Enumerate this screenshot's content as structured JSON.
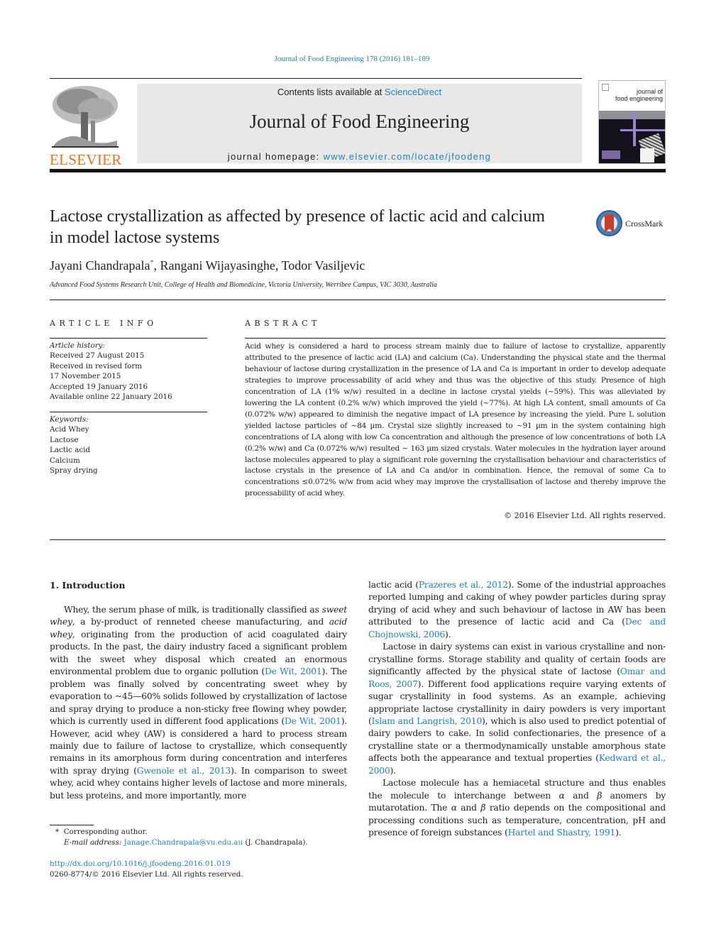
{
  "header": {
    "citation": "Journal of Food Engineering 178 (2016) 181–189",
    "publisher_logo_text": "ELSEVIER",
    "contents_prefix": "Contents lists available at ",
    "contents_link": "ScienceDirect",
    "journal_name": "Journal of Food Engineering",
    "homepage_prefix": "journal homepage: ",
    "homepage_link": "www.elsevier.com/locate/jfoodeng",
    "cover_title_line1": "journal of",
    "cover_title_line2": "food engineering",
    "crossmark_label": "CrossMark"
  },
  "article": {
    "title": "Lactose crystallization as affected by presence of lactic acid and calcium in model lactose systems",
    "authors": {
      "author1": "Jayani Chandrapala",
      "author1_mark": "*",
      "rest": ", Rangani Wijayasinghe, Todor Vasiljevic"
    },
    "affiliation": "Advanced Food Systems Research Unit, College of Health and Biomedicine, Victoria University, Werribee Campus, VIC 3030, Australia"
  },
  "article_info": {
    "heading": "ARTICLE INFO",
    "history_label": "Article history:",
    "history": [
      "Received 27 August 2015",
      "Received in revised form",
      "17 November 2015",
      "Accepted 19 January 2016",
      "Available online 22 January 2016"
    ],
    "keywords_label": "Keywords:",
    "keywords": [
      "Acid Whey",
      "Lactose",
      "Lactic acid",
      "Calcium",
      "Spray drying"
    ]
  },
  "abstract": {
    "heading": "ABSTRACT",
    "text": "Acid whey is considered a hard to process stream mainly due to failure of lactose to crystallize, apparently attributed to the presence of lactic acid (LA) and calcium (Ca). Understanding the physical state and the thermal behaviour of lactose during crystallization in the presence of LA and Ca is important in order to develop adequate strategies to improve processability of acid whey and thus was the objective of this study. Presence of high concentration of LA (1% w/w) resulted in a decline in lactose crystal yields (~59%). This was alleviated by lowering the LA content (0.2% w/w) which improved the yield (~77%). At high LA content, small amounts of Ca (0.072% w/w) appeared to diminish the negative impact of LA presence by increasing the yield. Pure L solution yielded lactose particles of ~84 µm. Crystal size slightly increased to ~91 µm in the system containing high concentrations of LA along with low Ca concentration and although the presence of low concentrations of both LA (0.2% w/w) and Ca (0.072% w/w) resulted ~ 163 µm sized crystals. Water molecules in the hydration layer around lactose molecules appeared to play a significant role governing the crystallisation behaviour and characteristics of lactose crystals in the presence of LA and Ca and/or in combination. Hence, the removal of some Ca to concentrations ≤0.072% w/w from acid whey may improve the crystallisation of lactose and thereby improve the processability of acid whey.",
    "copyright": "© 2016 Elsevier Ltd. All rights reserved."
  },
  "introduction": {
    "heading": "1.  Introduction",
    "left": {
      "p1_a": "Whey, the serum phase of milk, is traditionally classified as ",
      "p1_em1": "sweet whey",
      "p1_b": ", a by-product of renneted cheese manufacturing, and ",
      "p1_em2": "acid whey",
      "p1_c": ", originating from the production of acid coagulated dairy products. In the past, the dairy industry faced a significant problem with the sweet whey disposal which created an enormous environmental problem due to organic pollution (",
      "p1_ref1": "De Wit, 2001",
      "p1_d": "). The problem was finally solved by concentrating sweet whey by evaporation to ~45—60% solids followed by crystallization of lactose and spray drying to produce a non-sticky free flowing whey powder, which is currently used in different food applications (",
      "p1_ref2": "De Wit, 2001",
      "p1_e": "). However, acid whey (AW) is considered a hard to process stream mainly due to failure of lactose to crystallize, which consequently remains in its amorphous form during concentration and interferes with spray drying (",
      "p1_ref3": "Gwenole et al., 2013",
      "p1_f": "). In comparison to sweet whey, acid whey contains higher levels of lactose and more minerals, but less proteins, and more importantly, more"
    },
    "right": {
      "p1_a": "lactic acid (",
      "p1_ref1": "Prazeres et al., 2012",
      "p1_b": "). Some of the industrial approaches reported lumping and caking of whey powder particles during spray drying of acid whey and such behaviour of lactose in AW has been attributed to the presence of lactic acid and Ca (",
      "p1_ref2": "Dec and Chojnowski, 2006",
      "p1_c": ").",
      "p2_a": "Lactose in dairy systems can exist in various crystalline and non-crystalline forms. Storage stability and quality of certain foods are significantly affected by the physical state of lactose (",
      "p2_ref1": "Omar and Roos, 2007",
      "p2_b": "). Different food applications require varying extents of sugar crystallinity in food systems. As an example, achieving appropriate lactose crystallinity in dairy powders is very important (",
      "p2_ref2": "Islam and Langrish, 2010",
      "p2_c": "), which is also used to predict potential of dairy powders to cake. In solid confectionaries, the presence of a crystalline state or a thermodynamically unstable amorphous state affects both the appearance and textual properties (",
      "p2_ref3": "Kedward et al., 2000",
      "p2_d": ").",
      "p3_a": "Lactose molecule has a hemiacetal structure and thus enables the molecule to interchange between ",
      "alpha": "α",
      "p3_b": " and ",
      "beta": "β",
      "p3_c": " anomers by mutarotation. The ",
      "p3_d": " ratio depends on the compositional and processing conditions such as temperature, concentration, pH and presence of foreign substances (",
      "p3_ref1": "Hartel and Shastry, 1991",
      "p3_e": ")."
    }
  },
  "footnotes": {
    "mark": "*",
    "corresponding": "Corresponding author.",
    "email_label": "E-mail address: ",
    "email": "Janage.Chandrapala@vu.edu.au",
    "email_suffix": " (J. Chandrapala).",
    "doi": "http://dx.doi.org/10.1016/j.jfoodeng.2016.01.019",
    "issn_copyright": "0260-8774/© 2016 Elsevier Ltd. All rights reserved."
  }
}
